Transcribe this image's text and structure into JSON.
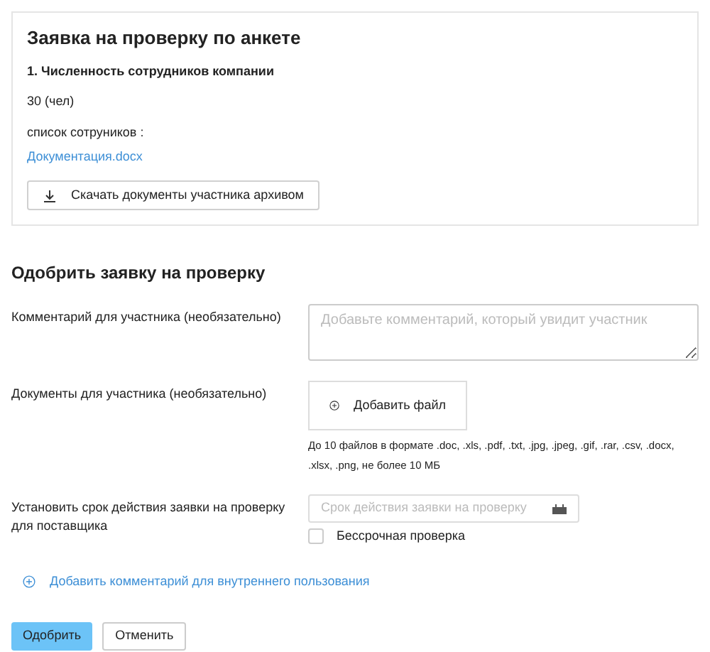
{
  "card": {
    "title": "Заявка на проверку по анкете",
    "question": "1. Численность сотрудников компании",
    "answer": "30 (чел)",
    "file_label": "список сотруников :",
    "file_link": "Документация.docx",
    "download_button": "Скачать документы участника архивом"
  },
  "approve": {
    "title": "Одобрить заявку на проверку",
    "comment": {
      "label": "Комментарий для участника (необязательно)",
      "placeholder": "Добавьте комментарий, который увидит участник"
    },
    "documents": {
      "label": "Документы для участника (необязательно)",
      "button": "Добавить файл",
      "hint": "До 10 файлов в формате .doc, .xls, .pdf, .txt, .jpg, .jpeg, .gif, .rar, .csv, .docx, .xlsx, .png, не более 10 МБ"
    },
    "term": {
      "label": "Установить срок действия заявки на проверку для поставщика",
      "placeholder": "Срок действия заявки на проверку",
      "checkbox": {
        "label": "Бессрочная проверка",
        "checked": false
      }
    },
    "internal_comment_link": "Добавить комментарий для внутреннего пользования",
    "buttons": [
      {
        "label": "Одобрить",
        "kind": "primary"
      },
      {
        "label": "Отменить",
        "kind": "secondary"
      }
    ]
  }
}
